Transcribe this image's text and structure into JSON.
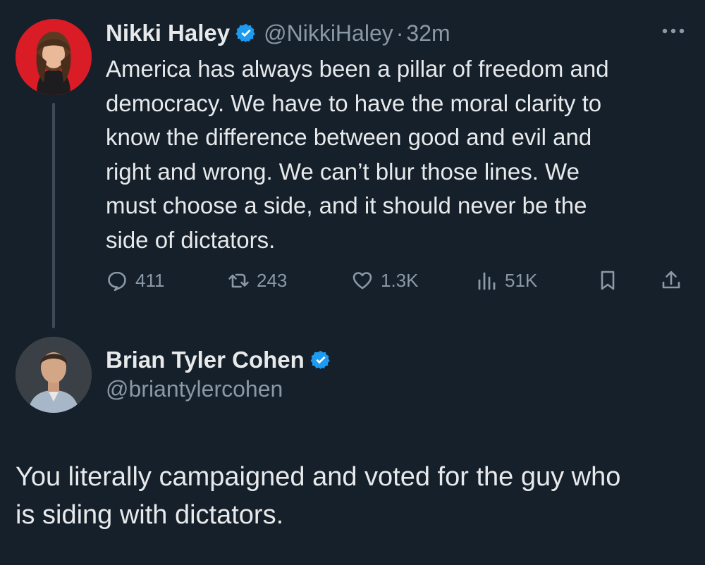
{
  "original_tweet": {
    "author": {
      "display_name": "Nikki Haley",
      "handle": "@NikkiHaley",
      "verified": true,
      "avatar_bg": "#d91c25"
    },
    "separator": "·",
    "time": "32m",
    "more_icon": "more-horizontal-icon",
    "text": "America has always been a pillar of freedom and\ndemocracy. We have to have the moral clarity to\nknow the difference between good and evil and\nright and wrong. We can’t blur those lines. We\nmust choose a side, and it should never be the\nside of dictators.",
    "actions": {
      "replies": "411",
      "retweets": "243",
      "likes": "1.3K",
      "views": "51K"
    }
  },
  "reply_tweet": {
    "author": {
      "display_name": "Brian Tyler Cohen",
      "handle": "@briantylercohen",
      "verified": true
    },
    "text": "You literally campaigned and voted for the guy who\nis siding with dictators."
  },
  "colors": {
    "background": "#15202b",
    "text_primary": "#e7e9ea",
    "text_secondary": "#8b98a5",
    "verified_blue": "#1d9bf0",
    "thread_line": "#3d4a56"
  }
}
